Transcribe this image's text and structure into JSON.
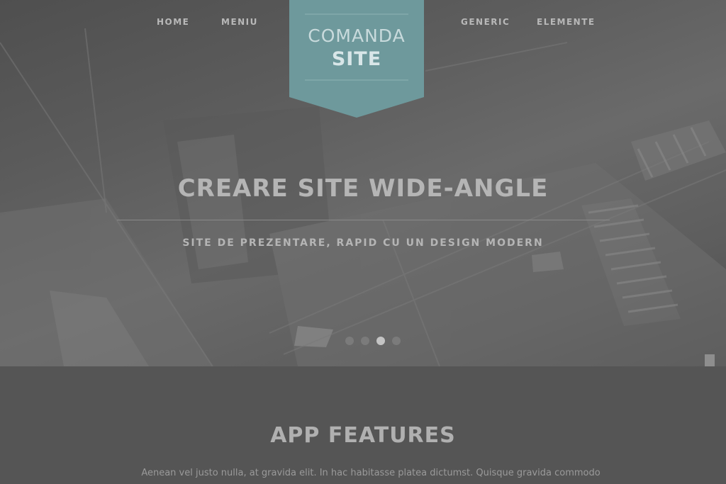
{
  "nav": {
    "left": [
      {
        "label": "HOME"
      },
      {
        "label": "MENIU"
      }
    ],
    "right": [
      {
        "label": "GENERIC"
      },
      {
        "label": "ELEMENTE"
      }
    ]
  },
  "logo": {
    "line1": "COMANDA",
    "line2": "SITE",
    "color": "#6e999c"
  },
  "hero": {
    "title": "CREARE SITE WIDE-ANGLE",
    "subtitle": "SITE DE PREZENTARE, RAPID CU UN DESIGN MODERN",
    "slides_count": 4,
    "active_slide": 3
  },
  "features": {
    "title": "APP FEATURES",
    "text": "Aenean vel justo nulla, at gravida elit. In hac habitasse platea dictumst. Quisque gravida commodo volutpat. Vivamus"
  }
}
